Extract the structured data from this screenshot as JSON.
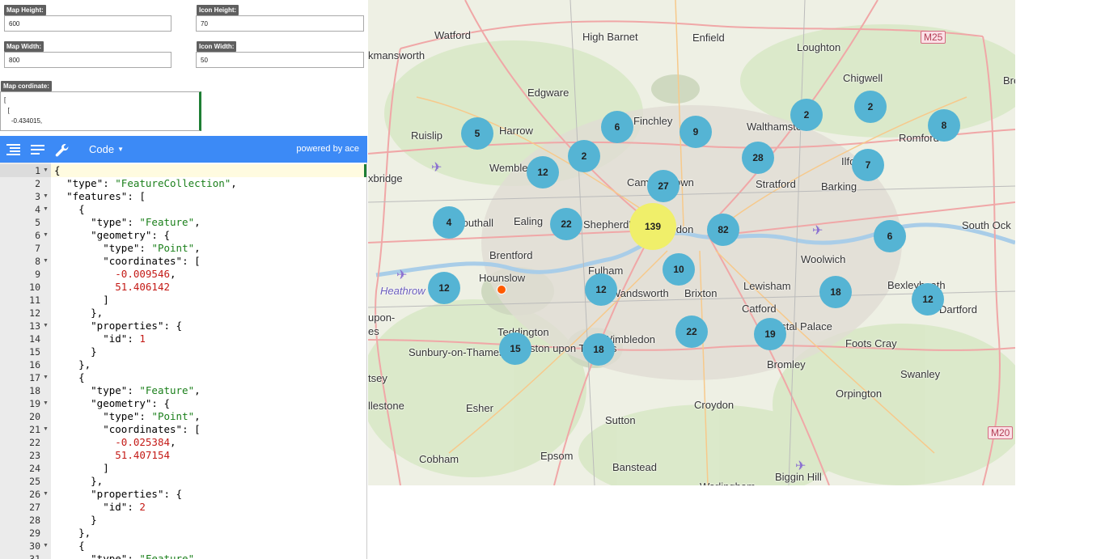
{
  "form": {
    "map_height_label": "Map Height:",
    "map_height_value": "600",
    "icon_height_label": "Icon Height:",
    "icon_height_value": "70",
    "map_width_label": "Map Width:",
    "map_width_value": "800",
    "icon_width_label": "Icon Width:",
    "icon_width_value": "50",
    "coord_label": "Map cordinate:",
    "coord_value": "[\n  [\n    -0.434015,"
  },
  "toolbar": {
    "mode_label": "Code",
    "powered_by": "powered by ace"
  },
  "editor": {
    "lines": [
      {
        "n": "1",
        "fold": true,
        "html": "<span class='k'>{</span>"
      },
      {
        "n": "2",
        "fold": false,
        "html": "  <span class='k'>\"type\"</span>: <span class='s'>\"FeatureCollection\"</span>,"
      },
      {
        "n": "3",
        "fold": true,
        "html": "  <span class='k'>\"features\"</span>: ["
      },
      {
        "n": "4",
        "fold": true,
        "html": "    {"
      },
      {
        "n": "5",
        "fold": false,
        "html": "      <span class='k'>\"type\"</span>: <span class='s'>\"Feature\"</span>,"
      },
      {
        "n": "6",
        "fold": true,
        "html": "      <span class='k'>\"geometry\"</span>: {"
      },
      {
        "n": "7",
        "fold": false,
        "html": "        <span class='k'>\"type\"</span>: <span class='s'>\"Point\"</span>,"
      },
      {
        "n": "8",
        "fold": true,
        "html": "        <span class='k'>\"coordinates\"</span>: ["
      },
      {
        "n": "9",
        "fold": false,
        "html": "          <span class='n'>-0.009546</span>,"
      },
      {
        "n": "10",
        "fold": false,
        "html": "          <span class='n'>51.406142</span>"
      },
      {
        "n": "11",
        "fold": false,
        "html": "        ]"
      },
      {
        "n": "12",
        "fold": false,
        "html": "      },"
      },
      {
        "n": "13",
        "fold": true,
        "html": "      <span class='k'>\"properties\"</span>: {"
      },
      {
        "n": "14",
        "fold": false,
        "html": "        <span class='k'>\"id\"</span>: <span class='n'>1</span>"
      },
      {
        "n": "15",
        "fold": false,
        "html": "      }"
      },
      {
        "n": "16",
        "fold": false,
        "html": "    },"
      },
      {
        "n": "17",
        "fold": true,
        "html": "    {"
      },
      {
        "n": "18",
        "fold": false,
        "html": "      <span class='k'>\"type\"</span>: <span class='s'>\"Feature\"</span>,"
      },
      {
        "n": "19",
        "fold": true,
        "html": "      <span class='k'>\"geometry\"</span>: {"
      },
      {
        "n": "20",
        "fold": false,
        "html": "        <span class='k'>\"type\"</span>: <span class='s'>\"Point\"</span>,"
      },
      {
        "n": "21",
        "fold": true,
        "html": "        <span class='k'>\"coordinates\"</span>: ["
      },
      {
        "n": "22",
        "fold": false,
        "html": "          <span class='n'>-0.025384</span>,"
      },
      {
        "n": "23",
        "fold": false,
        "html": "          <span class='n'>51.407154</span>"
      },
      {
        "n": "24",
        "fold": false,
        "html": "        ]"
      },
      {
        "n": "25",
        "fold": false,
        "html": "      },"
      },
      {
        "n": "26",
        "fold": true,
        "html": "      <span class='k'>\"properties\"</span>: {"
      },
      {
        "n": "27",
        "fold": false,
        "html": "        <span class='k'>\"id\"</span>: <span class='n'>2</span>"
      },
      {
        "n": "28",
        "fold": false,
        "html": "      }"
      },
      {
        "n": "29",
        "fold": false,
        "html": "    },"
      },
      {
        "n": "30",
        "fold": true,
        "html": "    {"
      },
      {
        "n": "31",
        "fold": false,
        "html": "      <span class='k'>\"type\"</span>: <span class='s'>\"Feature\"</span>,"
      }
    ]
  },
  "map": {
    "places": [
      "Watford",
      "High Barnet",
      "Enfield",
      "Loughton",
      "M25",
      "Bren",
      "kmansworth",
      "Chigwell",
      "Edgware",
      "Ruislip",
      "Harrow",
      "Finchley",
      "Walthamstow",
      "Romford",
      "Wembley",
      "Camden Town",
      "Stratford",
      "Ilford",
      "Barking",
      "xbridge",
      "Southall",
      "Ealing",
      "Shepherd's Bush",
      "London",
      "South Ock",
      "Brentford",
      "Fulham",
      "Woolwich",
      "Heathrow",
      "Hounslow",
      "Wandsworth",
      "Brixton",
      "Lewisham",
      "Bexleyheath",
      "Dartford",
      "upon-",
      "es",
      "Teddington",
      "Catford",
      "Bromley",
      "Kingston upon Thames",
      "Wimbledon",
      "Crystal Palace",
      "Sunbury-on-Thames",
      "Foots Cray",
      "Swanley",
      "tsey",
      "llestone",
      "Esher",
      "Croydon",
      "Orpington",
      "Sutton",
      "M20",
      "Cobham",
      "Epsom",
      "Banstead",
      "Biggin Hill",
      "Warlingham"
    ],
    "clusters": [
      "5",
      "6",
      "9",
      "2",
      "2",
      "8",
      "2",
      "12",
      "28",
      "7",
      "27",
      "4",
      "22",
      "139",
      "82",
      "6",
      "10",
      "12",
      "12",
      "18",
      "12",
      "22",
      "19",
      "15",
      "18"
    ]
  }
}
